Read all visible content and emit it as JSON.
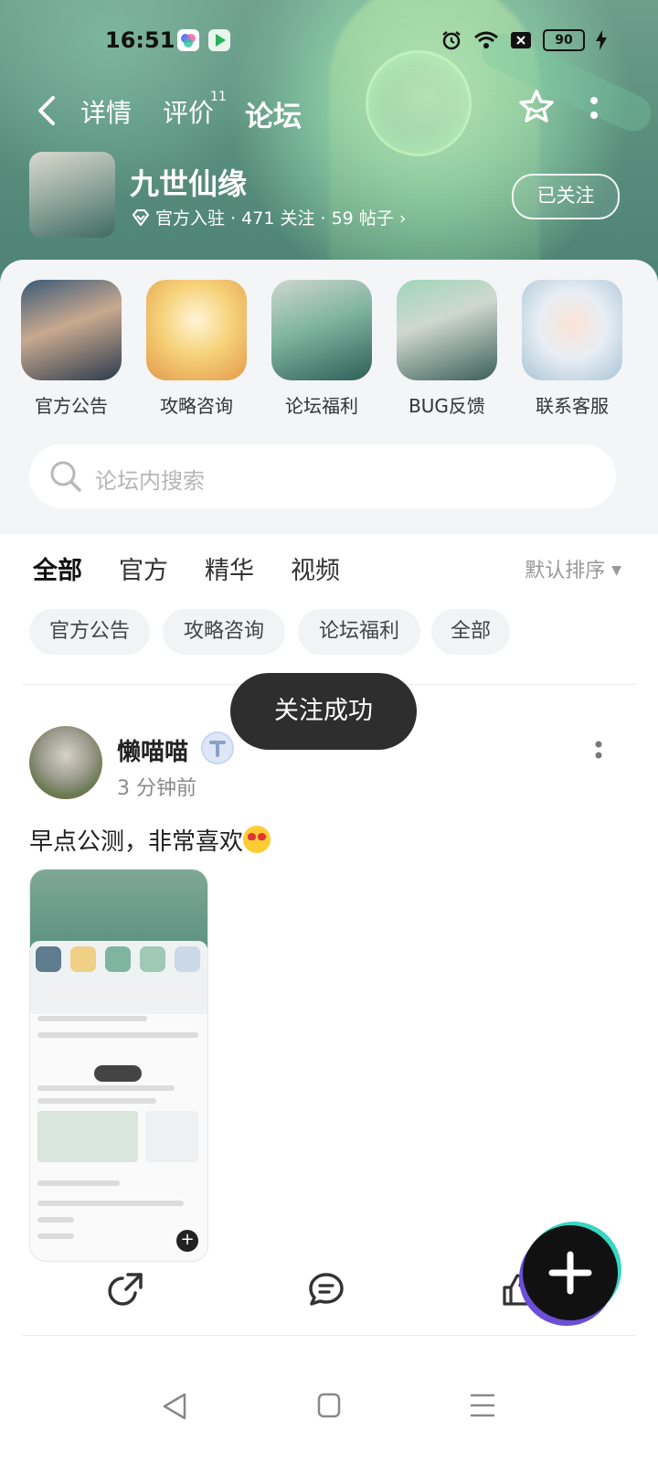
{
  "status_bar": {
    "time": "16:51",
    "battery": "90"
  },
  "nav": {
    "tabs": [
      {
        "label": "详情"
      },
      {
        "label": "评价",
        "badge": "11"
      },
      {
        "label": "论坛"
      }
    ]
  },
  "game": {
    "name": "九世仙缘",
    "meta": "官方入驻 · 471 关注 · 59 帖子 ›",
    "follow_label": "已关注"
  },
  "categories": [
    {
      "label": "官方公告"
    },
    {
      "label": "攻略咨询"
    },
    {
      "label": "论坛福利"
    },
    {
      "label": "BUG反馈"
    },
    {
      "label": "联系客服"
    }
  ],
  "search": {
    "placeholder": "论坛内搜索"
  },
  "filter_tabs": [
    {
      "label": "全部"
    },
    {
      "label": "官方"
    },
    {
      "label": "精华"
    },
    {
      "label": "视频"
    }
  ],
  "sort_label": "默认排序",
  "chips": [
    {
      "label": "官方公告"
    },
    {
      "label": "攻略咨询"
    },
    {
      "label": "论坛福利"
    },
    {
      "label": "全部"
    }
  ],
  "post": {
    "author": "懒喵喵",
    "time": "3 分钟前",
    "text": "早点公测，非常喜欢"
  },
  "toast": "关注成功",
  "colors": {
    "accent": "#2fd1b8",
    "hero": "#5a8f7e"
  },
  "icons": [
    "back-icon",
    "star-icon",
    "more-icon",
    "search-icon",
    "share-icon",
    "comment-icon",
    "like-icon",
    "plus-icon"
  ]
}
